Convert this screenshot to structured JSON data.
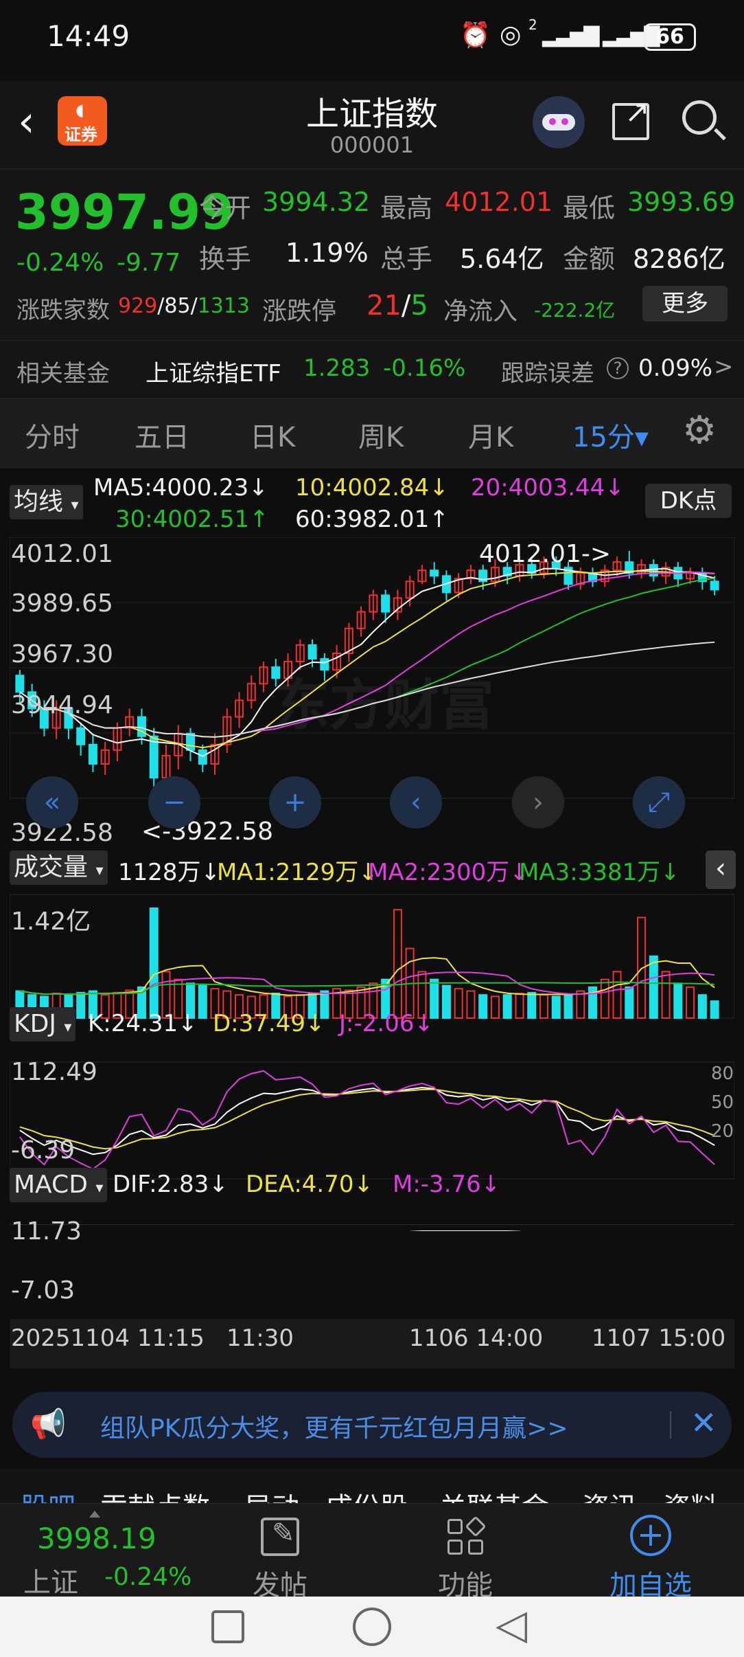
{
  "status": {
    "time": "14:49",
    "battery": "66",
    "signal_sup": "2"
  },
  "header": {
    "title": "上证指数",
    "code": "000001",
    "logo_text": "证券"
  },
  "quote": {
    "price": "3997.99",
    "pct": "-0.24%",
    "chg": "-9.77",
    "open_label": "今开",
    "open": "3994.32",
    "high_label": "最高",
    "high": "4012.01",
    "low_label": "最低",
    "low": "3993.69",
    "turnover_label": "换手",
    "turnover": "1.19%",
    "volume_label": "总手",
    "volume": "5.64亿",
    "amount_label": "金额",
    "amount": "8286亿",
    "breadth_label": "涨跌家数",
    "breadth_up": "929",
    "breadth_flat": "85",
    "breadth_down": "1313",
    "limit_label": "涨跌停",
    "limit_up": "21",
    "limit_down": "5",
    "netflow_label": "净流入",
    "netflow": "-222.2亿",
    "more": "更多"
  },
  "fund": {
    "label": "相关基金",
    "name": "上证综指ETF",
    "price": "1.283",
    "pct": "-0.16%",
    "err_label": "跟踪误差",
    "err_value": "0.09%",
    "chevron": ">"
  },
  "tabs": [
    "分时",
    "五日",
    "日K",
    "周K",
    "月K",
    "15分▾"
  ],
  "ma_bar": {
    "label": "均线",
    "ma5": "MA5:4000.23↓",
    "ma10": "10:4002.84↓",
    "ma20": "20:4003.44↓",
    "ma30": "30:4002.51↑",
    "ma60": "60:3982.01↑",
    "dk": "DK点"
  },
  "price_axis": {
    "top": "4012.01",
    "l2": "3989.65",
    "l3": "3967.30",
    "l4": "3944.94",
    "bottom": "3922.58",
    "high_ann": "4012.01->",
    "low_ann": "<-3922.58"
  },
  "watermark": "东方财富",
  "volume_bar": {
    "label": "成交量",
    "value": "1128万↓",
    "ma1": "MA1:2129万↓",
    "ma2": "MA2:2300万↓",
    "ma3": "MA3:3381万↓",
    "axis": "1.42亿"
  },
  "kdj_bar": {
    "label": "KDJ",
    "k": "K:24.31↓",
    "d": "D:37.49↓",
    "j": "J:-2.06↓",
    "top": "112.49",
    "bottom": "-6.39",
    "r80": "80",
    "r50": "50",
    "r20": "20"
  },
  "macd_bar": {
    "label": "MACD",
    "dif": "DIF:2.83↓",
    "dea": "DEA:4.70↓",
    "m": "M:-3.76↓",
    "top": "11.73",
    "bottom": "-7.03"
  },
  "time_axis": {
    "t1": "20251104 11:15",
    "t2": "11:30",
    "t3": "1106 14:00",
    "t4": "1107 15:00"
  },
  "banner": {
    "text": "组队PK瓜分大奖，更有千元红包月月赢>>"
  },
  "bottom_tabs": [
    "股吧",
    "贡献点数",
    "异动",
    "成份股",
    "关联基金",
    "资讯",
    "资料"
  ],
  "bottombar": {
    "price": "3998.19",
    "name": "上证",
    "pct": "-0.24%",
    "post": "发帖",
    "func": "功能",
    "add": "加自选"
  },
  "colors": {
    "up": "#f2302c",
    "down": "#22c02a",
    "accent": "#3d8ef0",
    "candle_down": "#1ee0e8"
  },
  "chart_data": {
    "type": "candlestick",
    "candles": [
      [
        3967,
        3961,
        3969,
        3957
      ],
      [
        3961,
        3955,
        3964,
        3952
      ],
      [
        3955,
        3948,
        3958,
        3945
      ],
      [
        3948,
        3955,
        3958,
        3944
      ],
      [
        3955,
        3948,
        3957,
        3944
      ],
      [
        3948,
        3942,
        3950,
        3938
      ],
      [
        3942,
        3935,
        3946,
        3932
      ],
      [
        3935,
        3940,
        3943,
        3931
      ],
      [
        3940,
        3948,
        3950,
        3936
      ],
      [
        3948,
        3952,
        3955,
        3945
      ],
      [
        3952,
        3945,
        3955,
        3942
      ],
      [
        3945,
        3930,
        3948,
        3922.58
      ],
      [
        3930,
        3938,
        3942,
        3925
      ],
      [
        3938,
        3946,
        3949,
        3933
      ],
      [
        3946,
        3940,
        3948,
        3936
      ],
      [
        3940,
        3935,
        3942,
        3932
      ],
      [
        3935,
        3942,
        3946,
        3931
      ],
      [
        3942,
        3952,
        3955,
        3939
      ],
      [
        3952,
        3958,
        3961,
        3948
      ],
      [
        3958,
        3964,
        3967,
        3955
      ],
      [
        3964,
        3970,
        3972,
        3961
      ],
      [
        3970,
        3966,
        3973,
        3963
      ],
      [
        3966,
        3972,
        3975,
        3963
      ],
      [
        3972,
        3978,
        3980,
        3969
      ],
      [
        3978,
        3973,
        3980,
        3970
      ],
      [
        3973,
        3969,
        3975,
        3965
      ],
      [
        3969,
        3975,
        3978,
        3966
      ],
      [
        3975,
        3984,
        3986,
        3972
      ],
      [
        3984,
        3990,
        3992,
        3981
      ],
      [
        3990,
        3996,
        3998,
        3987
      ],
      [
        3996,
        3990,
        3998,
        3986
      ],
      [
        3990,
        3995,
        3998,
        3987
      ],
      [
        3995,
        4001,
        4003,
        3992
      ],
      [
        4001,
        4005,
        4007,
        4000
      ],
      [
        4005,
        4003,
        4008,
        4000
      ],
      [
        4003,
        3997,
        4005,
        3994
      ],
      [
        3997,
        4002,
        4004,
        3995
      ],
      [
        4002,
        4005,
        4007,
        4000
      ],
      [
        4005,
        4001,
        4007,
        3998
      ],
      [
        4001,
        4006,
        4009,
        3999
      ],
      [
        4006,
        4003,
        4008,
        4000
      ],
      [
        4003,
        4007,
        4010,
        4001
      ],
      [
        4007,
        4004,
        4009,
        4002
      ],
      [
        4004,
        4008,
        4010,
        4002
      ],
      [
        4008,
        4006,
        4010,
        4003
      ],
      [
        4006,
        4000,
        4008,
        3998
      ],
      [
        4000,
        4004,
        4006,
        3998
      ],
      [
        4004,
        4001,
        4006,
        3999
      ],
      [
        4001,
        4005,
        4007,
        3999
      ],
      [
        4005,
        4008,
        4010,
        4003
      ],
      [
        4008,
        4004,
        4012.01,
        4002
      ],
      [
        4004,
        4007,
        4009,
        4002
      ],
      [
        4007,
        4003,
        4009,
        4001
      ],
      [
        4003,
        4006,
        4008,
        4000
      ],
      [
        4006,
        4002,
        4008,
        3999
      ],
      [
        4002,
        4004,
        4006,
        4000
      ],
      [
        4004,
        4001,
        4006,
        3998
      ],
      [
        4001,
        3998,
        4003,
        3996
      ]
    ],
    "volumes": [
      0.35,
      0.3,
      0.28,
      0.32,
      0.3,
      0.33,
      0.35,
      0.3,
      0.33,
      0.36,
      0.4,
      1.42,
      0.6,
      0.5,
      0.45,
      0.42,
      0.38,
      0.35,
      0.3,
      0.28,
      0.3,
      0.32,
      0.28,
      0.3,
      0.32,
      0.35,
      0.38,
      0.36,
      0.4,
      0.45,
      0.5,
      1.4,
      0.9,
      0.6,
      0.5,
      0.42,
      0.38,
      0.35,
      0.3,
      0.28,
      0.3,
      0.32,
      0.33,
      0.3,
      0.28,
      0.3,
      0.35,
      0.4,
      0.5,
      0.6,
      0.4,
      1.3,
      0.8,
      0.6,
      0.45,
      0.4,
      0.3,
      0.22
    ],
    "kdj_range": [
      -6.39,
      112.49
    ],
    "macd_range": [
      -7.03,
      11.73
    ]
  }
}
